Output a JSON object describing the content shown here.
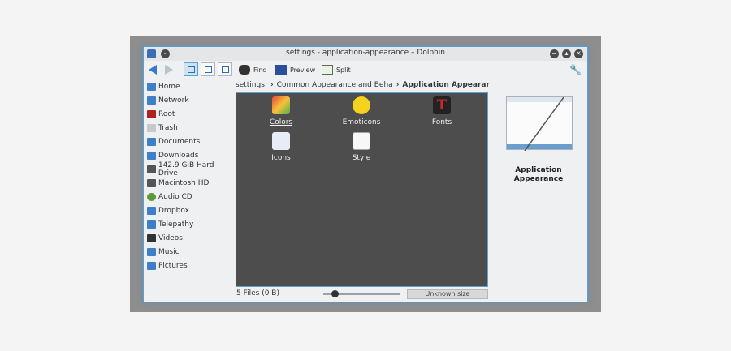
{
  "window": {
    "title": "settings - application-appearance – Dolphin",
    "buttons": {
      "minimize": "−",
      "maximize": "▴",
      "close": "×"
    }
  },
  "toolbar": {
    "find_label": "Find",
    "preview_label": "Preview",
    "split_label": "Split",
    "icons": [
      "back-arrow-icon",
      "forward-arrow-icon",
      "icons-view-icon",
      "compact-view-icon",
      "details-view-icon",
      "binoculars-icon",
      "preview-icon",
      "split-icon",
      "wrench-icon"
    ]
  },
  "places": [
    {
      "label": "Home",
      "icon": "home-folder-icon"
    },
    {
      "label": "Network",
      "icon": "network-folder-icon"
    },
    {
      "label": "Root",
      "icon": "root-folder-icon",
      "color": "#b02020"
    },
    {
      "label": "Trash",
      "icon": "trash-icon"
    },
    {
      "label": "Documents",
      "icon": "documents-folder-icon"
    },
    {
      "label": "Downloads",
      "icon": "downloads-folder-icon"
    },
    {
      "label": "142.9 GiB Hard Drive",
      "icon": "hard-drive-icon"
    },
    {
      "label": "Macintosh HD",
      "icon": "hard-drive-icon"
    },
    {
      "label": "Audio CD",
      "icon": "audio-cd-icon"
    },
    {
      "label": "Dropbox",
      "icon": "folder-icon"
    },
    {
      "label": "Telepathy",
      "icon": "folder-icon"
    },
    {
      "label": "Videos",
      "icon": "videos-folder-icon"
    },
    {
      "label": "Music",
      "icon": "music-folder-icon"
    },
    {
      "label": "Pictures",
      "icon": "pictures-folder-icon"
    }
  ],
  "breadcrumb": {
    "root": "settings:",
    "parent": "Common Appearance and Beha",
    "current": "Application Appearance"
  },
  "files": [
    {
      "label": "Colors",
      "icon": "colors-icon"
    },
    {
      "label": "Emoticons",
      "icon": "emoticon-smiley-icon"
    },
    {
      "label": "Fonts",
      "icon": "fonts-icon"
    },
    {
      "label": "Icons",
      "icon": "icons-icon"
    },
    {
      "label": "Style",
      "icon": "style-icon"
    }
  ],
  "status": {
    "count": "5 Files (0 B)",
    "zoom_fraction": 0.15,
    "size": "Unknown size"
  },
  "info_panel": {
    "title_line1": "Application",
    "title_line2": "Appearance"
  },
  "colors": {
    "accent": "#5aa0d3",
    "view_bg": "#4d4d4d",
    "window_bg": "#eff0f1"
  }
}
